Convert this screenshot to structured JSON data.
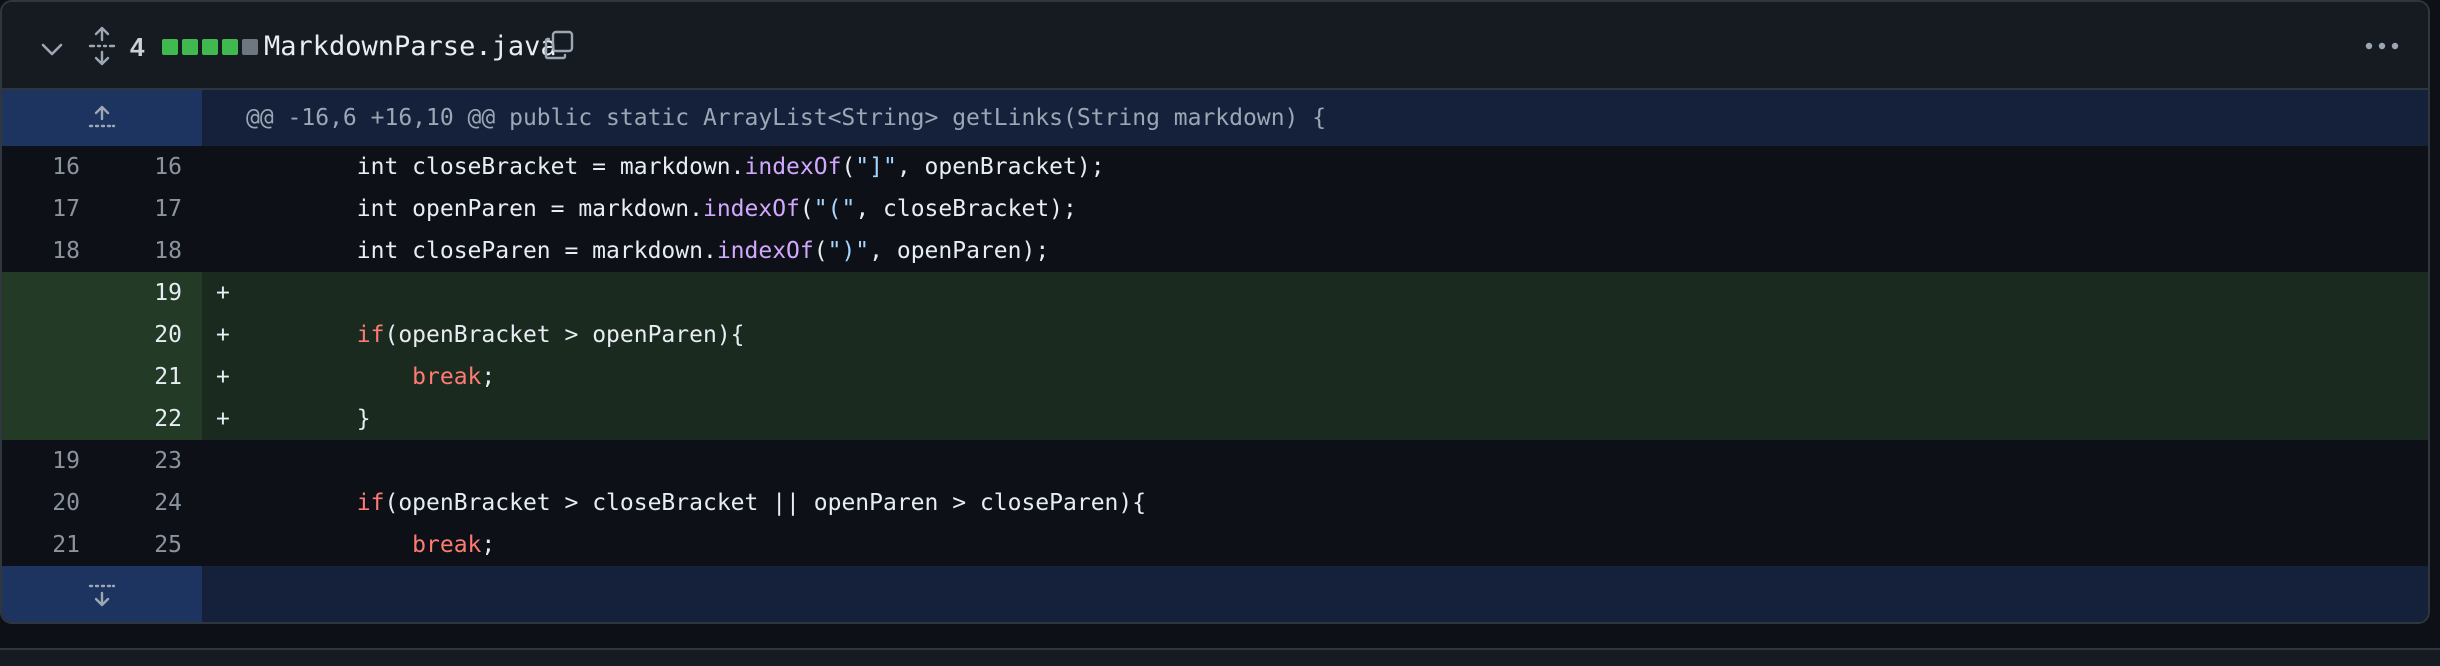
{
  "file": {
    "name": "MarkdownParse.java",
    "changes": "4",
    "diffstat": [
      "#3fb950",
      "#3fb950",
      "#3fb950",
      "#3fb950",
      "#6e7681"
    ]
  },
  "hunk": {
    "header": "@@ -16,6 +16,10 @@ public static ArrayList<String> getLinks(String markdown) {"
  },
  "lines": [
    {
      "type": "ctx",
      "old": "16",
      "new": "16",
      "marker": "",
      "tokens": [
        [
          "",
          "        int closeBracket = markdown."
        ],
        [
          "fn",
          "indexOf"
        ],
        [
          "",
          "("
        ],
        [
          "str",
          "\"]\""
        ],
        [
          "",
          ", openBracket);"
        ]
      ]
    },
    {
      "type": "ctx",
      "old": "17",
      "new": "17",
      "marker": "",
      "tokens": [
        [
          "",
          "        int openParen = markdown."
        ],
        [
          "fn",
          "indexOf"
        ],
        [
          "",
          "("
        ],
        [
          "str",
          "\"(\""
        ],
        [
          "",
          ", closeBracket);"
        ]
      ]
    },
    {
      "type": "ctx",
      "old": "18",
      "new": "18",
      "marker": "",
      "tokens": [
        [
          "",
          "        int closeParen = markdown."
        ],
        [
          "fn",
          "indexOf"
        ],
        [
          "",
          "("
        ],
        [
          "str",
          "\")\""
        ],
        [
          "",
          ", openParen);"
        ]
      ]
    },
    {
      "type": "add",
      "old": "",
      "new": "19",
      "marker": "+",
      "tokens": []
    },
    {
      "type": "add",
      "old": "",
      "new": "20",
      "marker": "+",
      "tokens": [
        [
          "",
          "        "
        ],
        [
          "kw",
          "if"
        ],
        [
          "",
          "(openBracket > openParen){"
        ]
      ]
    },
    {
      "type": "add",
      "old": "",
      "new": "21",
      "marker": "+",
      "tokens": [
        [
          "",
          "            "
        ],
        [
          "kw",
          "break"
        ],
        [
          "",
          ";"
        ]
      ]
    },
    {
      "type": "add",
      "old": "",
      "new": "22",
      "marker": "+",
      "tokens": [
        [
          "",
          "        }"
        ]
      ]
    },
    {
      "type": "ctx",
      "old": "19",
      "new": "23",
      "marker": "",
      "tokens": []
    },
    {
      "type": "ctx",
      "old": "20",
      "new": "24",
      "marker": "",
      "tokens": [
        [
          "",
          "        "
        ],
        [
          "kw",
          "if"
        ],
        [
          "",
          "(openBracket > closeBracket || openParen > closeParen){"
        ]
      ]
    },
    {
      "type": "ctx",
      "old": "21",
      "new": "25",
      "marker": "",
      "tokens": [
        [
          "",
          "            "
        ],
        [
          "kw",
          "break"
        ],
        [
          "",
          ";"
        ]
      ]
    }
  ],
  "icons": {
    "collapse": "chevron-down-icon",
    "expand_all": "unfold-icon",
    "copy": "copy-icon",
    "more": "kebab-horizontal-icon",
    "expand_up": "expand-up-icon",
    "expand_down": "expand-down-icon"
  }
}
